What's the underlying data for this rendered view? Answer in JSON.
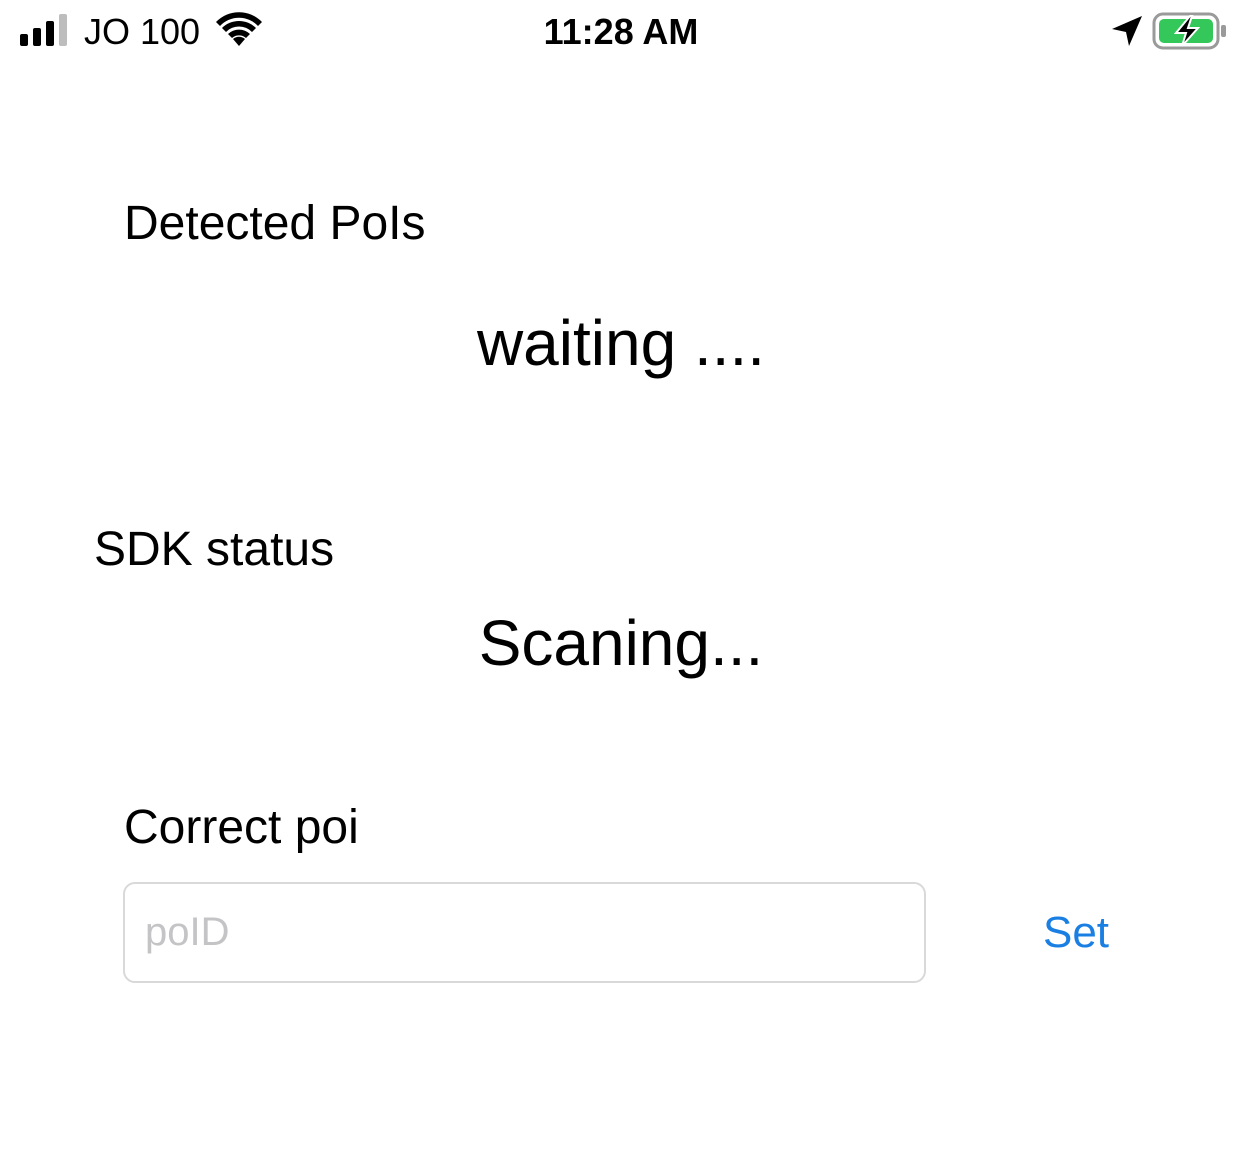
{
  "status_bar": {
    "carrier": "JO 100",
    "time": "11:28 AM",
    "icons": {
      "signal": "cellular-signal-icon",
      "wifi": "wifi-icon",
      "location": "location-arrow-icon",
      "battery": "battery-charging-icon"
    },
    "battery_color": "#34c759"
  },
  "detected": {
    "label": "Detected PoIs",
    "value": "waiting ...."
  },
  "sdk": {
    "label": "SDK status",
    "value": "Scaning..."
  },
  "correct_poi": {
    "label": "Correct poi",
    "input_placeholder": "poID",
    "input_value": "",
    "button_label": "Set"
  },
  "colors": {
    "accent": "#1a7fe3",
    "placeholder": "#c4c4c6",
    "input_border": "#d9d9d9"
  }
}
